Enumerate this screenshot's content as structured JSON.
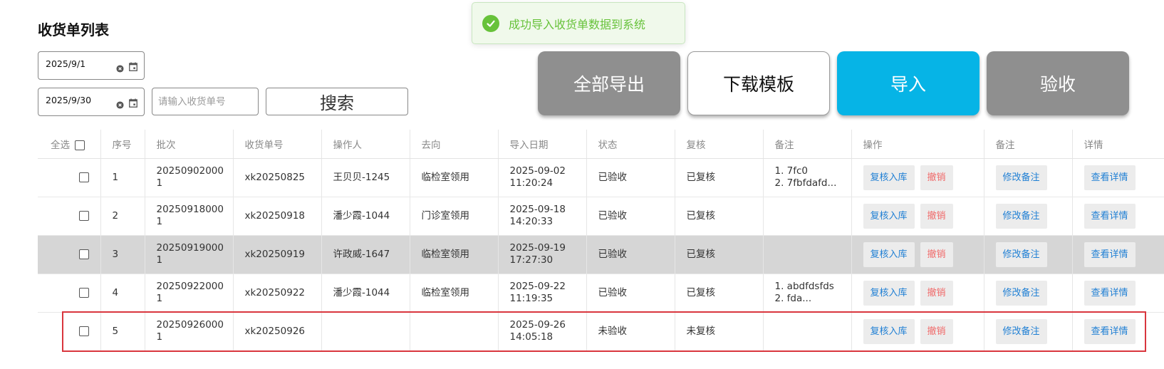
{
  "page": {
    "title": "收货单列表"
  },
  "toast": {
    "message": "成功导入收货单数据到系统"
  },
  "filters": {
    "start_date": "2025/9/1",
    "end_date": "2025/9/30",
    "order_placeholder": "请输入收货单号",
    "search_label": "搜索"
  },
  "actions": {
    "export_all": "全部导出",
    "download_template": "下载模板",
    "import": "导入",
    "inspect": "验收"
  },
  "colors": {
    "accent_blue": "#06b4e6",
    "gray_button": "#8f8f8f",
    "success_green": "#67c23a",
    "danger_red": "#d9363e"
  },
  "table": {
    "select_all_label": "全选",
    "headers": [
      "序号",
      "批次",
      "收货单号",
      "操作人",
      "去向",
      "导入日期",
      "状态",
      "复核",
      "备注",
      "操作",
      "备注",
      "详情"
    ],
    "action_labels": {
      "review": "复核入库",
      "revoke": "撤销",
      "edit_note": "修改备注",
      "view": "查看详情"
    },
    "rows": [
      {
        "no": "1",
        "batch_a": "20250902000",
        "batch_b": "1",
        "order": "xk20250825",
        "operator": "王贝贝-1245",
        "dest": "临检室领用",
        "date": "2025-09-02",
        "time": "11:20:24",
        "status": "已验收",
        "review": "已复核",
        "note_1": "1. 7fc0",
        "note_2": "2. 7fbfdafd..."
      },
      {
        "no": "2",
        "batch_a": "20250918000",
        "batch_b": "1",
        "order": "xk20250918",
        "operator": "潘少霞-1044",
        "dest": "门诊室领用",
        "date": "2025-09-18",
        "time": "14:20:33",
        "status": "已验收",
        "review": "已复核",
        "note_1": "",
        "note_2": ""
      },
      {
        "no": "3",
        "batch_a": "20250919000",
        "batch_b": "1",
        "order": "xk20250919",
        "operator": "许政威-1647",
        "dest": "临检室领用",
        "date": "2025-09-19",
        "time": "17:27:30",
        "status": "已验收",
        "review": "已复核",
        "note_1": "",
        "note_2": ""
      },
      {
        "no": "4",
        "batch_a": "20250922000",
        "batch_b": "1",
        "order": "xk20250922",
        "operator": "潘少霞-1044",
        "dest": "临检室领用",
        "date": "2025-09-22",
        "time": "11:19:35",
        "status": "已验收",
        "review": "已复核",
        "note_1": "1. abdfdsfds",
        "note_2": "2. fda..."
      },
      {
        "no": "5",
        "batch_a": "20250926000",
        "batch_b": "1",
        "order": "xk20250926",
        "operator": "",
        "dest": "",
        "date": "2025-09-26",
        "time": "14:05:18",
        "status": "未验收",
        "review": "未复核",
        "note_1": "",
        "note_2": ""
      }
    ]
  }
}
